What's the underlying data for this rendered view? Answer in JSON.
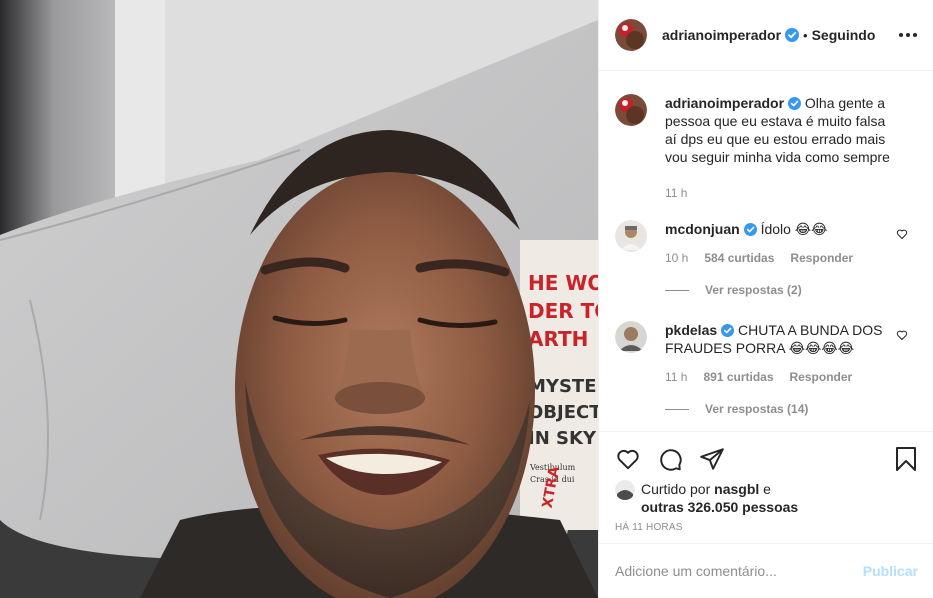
{
  "post": {
    "author": "adrianoimperador",
    "separator": "•",
    "follow_state": "Seguindo"
  },
  "caption": {
    "author": "adrianoimperador",
    "text": "Olha gente a pessoa que eu estava é muito falsa aí dps eu que eu estou errado mais vou seguir minha vida como sempre",
    "age": "11 h"
  },
  "comments": [
    {
      "user": "mcdonjuan",
      "text": "Ídolo 😂😂",
      "age": "10 h",
      "likes": "584 curtidas",
      "reply_label": "Responder",
      "view_replies": "Ver respostas (2)"
    },
    {
      "user": "pkdelas",
      "text": "CHUTA A BUNDA DOS FRAUDES PORRA 😂😂😂😂",
      "age": "11 h",
      "likes": "891 curtidas",
      "reply_label": "Responder",
      "view_replies": "Ver respostas (14)"
    }
  ],
  "likes": {
    "prefix": "Curtido por",
    "user": "nasgbl",
    "conj": "e",
    "others": "outras 326.050 pessoas"
  },
  "timestamp": "HÁ 11 HORAS",
  "add_comment": {
    "placeholder": "Adicione um comentário...",
    "publish_label": "Publicar"
  },
  "photo_text": {
    "line1": "HE WORLD",
    "line2": "DER TO",
    "line3": "ARTH",
    "line4": "MYSTERY",
    "line5": "OBJECTS",
    "line6": "IN SKY O",
    "small1": "Vestibulum",
    "small2": "Cras id dui",
    "small3": "XTRA"
  },
  "colors": {
    "verified": "#3897f0",
    "publish_disabled": "#b2dffc",
    "meta_gray": "#8e8e8e",
    "border": "#efefef"
  },
  "icons": [
    "verified-badge-icon",
    "more-options-icon",
    "heart-icon",
    "comment-icon",
    "share-icon",
    "bookmark-icon"
  ]
}
